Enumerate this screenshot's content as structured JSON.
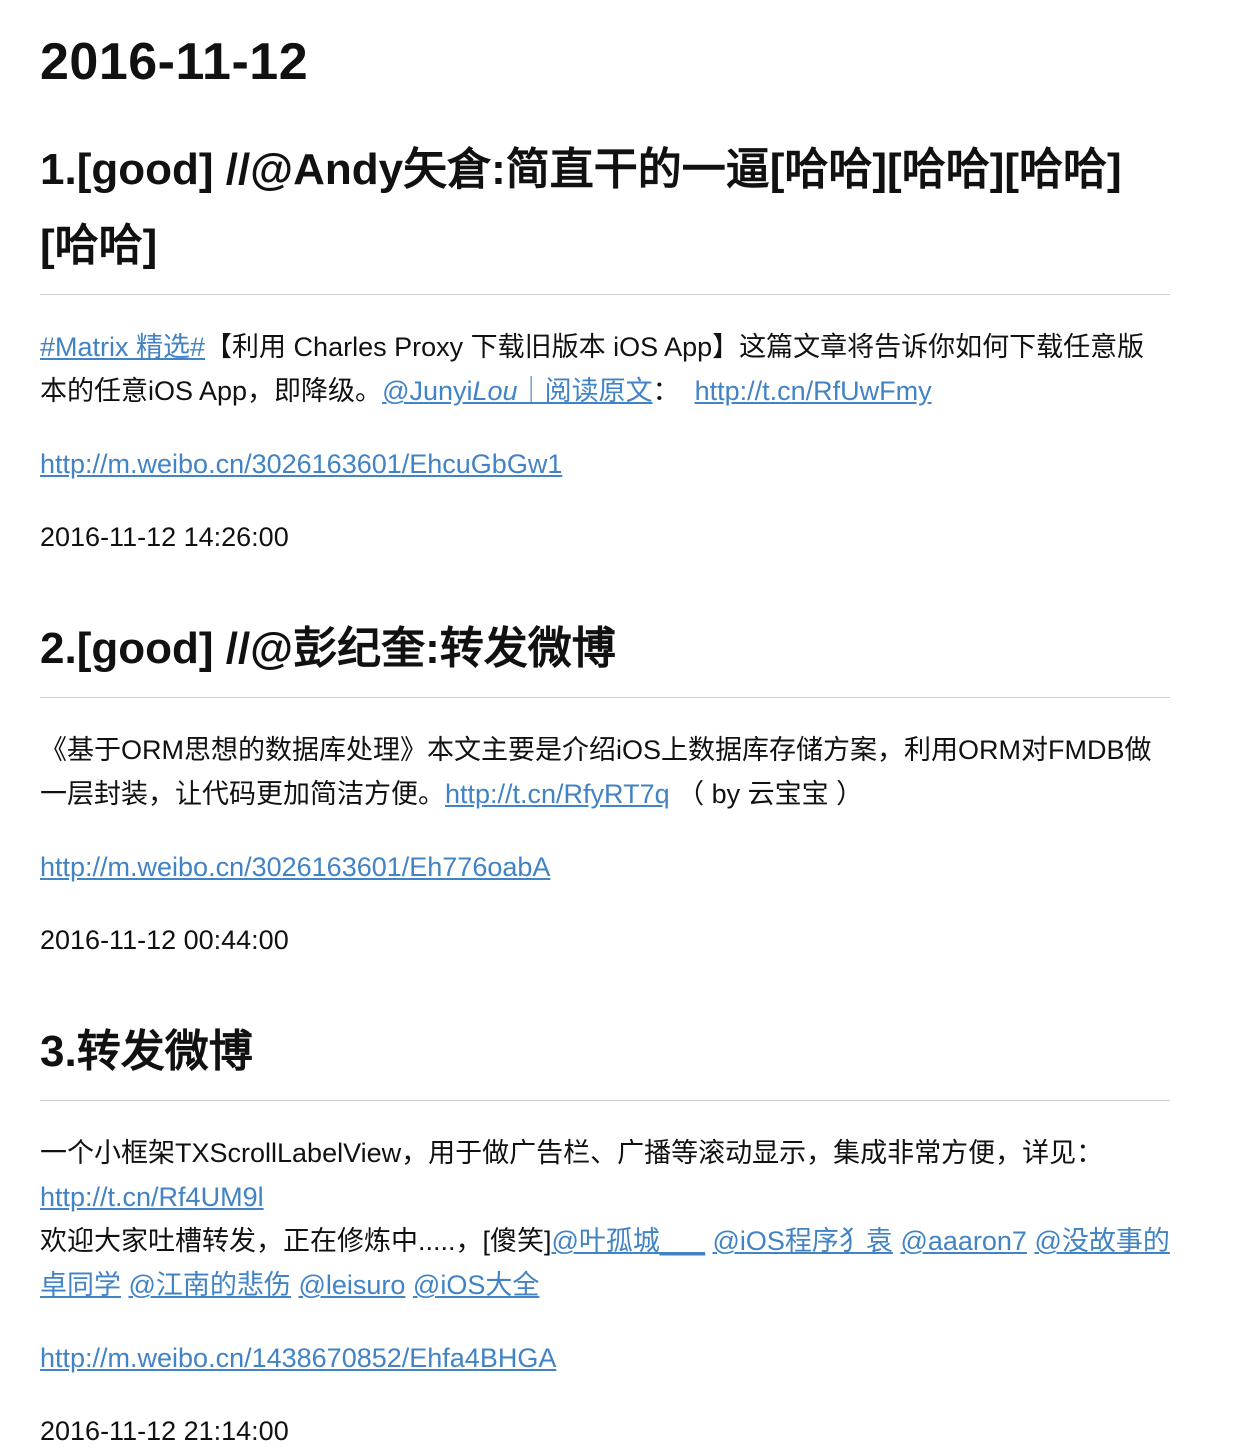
{
  "page": {
    "date_heading": "2016-11-12"
  },
  "posts": [
    {
      "title": "1.[good] //@Andy矢倉:简直干的一逼[哈哈][哈哈][哈哈][哈哈]",
      "body": {
        "tag_link": "#Matrix 精选#",
        "text_1": "【利用 Charles Proxy 下载旧版本 iOS App】这篇文章将告诉你如何下载任意版本的任意iOS App，即降级。",
        "mention_a": "@Junyi",
        "mention_b": "Lou",
        "mention_c": "｜阅读原文",
        "text_2": "：",
        "short_link": "http://t.cn/RfUwFmy"
      },
      "weibo_link": "http://m.weibo.cn/3026163601/EhcuGbGw1",
      "time": "2016-11-12 14:26:00"
    },
    {
      "title": "2.[good] //@彭纪奎:转发微博",
      "body": {
        "text_1": "《基于ORM思想的数据库处理》本文主要是介绍iOS上数据库存储方案，利用ORM对FMDB做一层封装，让代码更加简洁方便。",
        "short_link": "http://t.cn/RfyRT7q",
        "text_2": " （ by 云宝宝 ）"
      },
      "weibo_link": "http://m.weibo.cn/3026163601/Eh776oabA",
      "time": "2016-11-12 00:44:00"
    },
    {
      "title": "3.转发微博",
      "body": {
        "text_1": "一个小框架TXScrollLabelView，用于做广告栏、广播等滚动显示，集成非常方便，详见：",
        "short_link": "http://t.cn/Rf4UM9l",
        "text_2": "欢迎大家吐槽转发，正在修炼中.....，[傻笑]",
        "mentions": [
          "@叶孤城___",
          "@iOS程序犭袁",
          "@aaaron7",
          "@没故事的卓同学",
          "@江南的悲伤",
          "@leisuro",
          "@iOS大全"
        ]
      },
      "weibo_link": "http://m.weibo.cn/1438670852/Ehfa4BHGA",
      "time": "2016-11-12 21:14:00"
    }
  ]
}
